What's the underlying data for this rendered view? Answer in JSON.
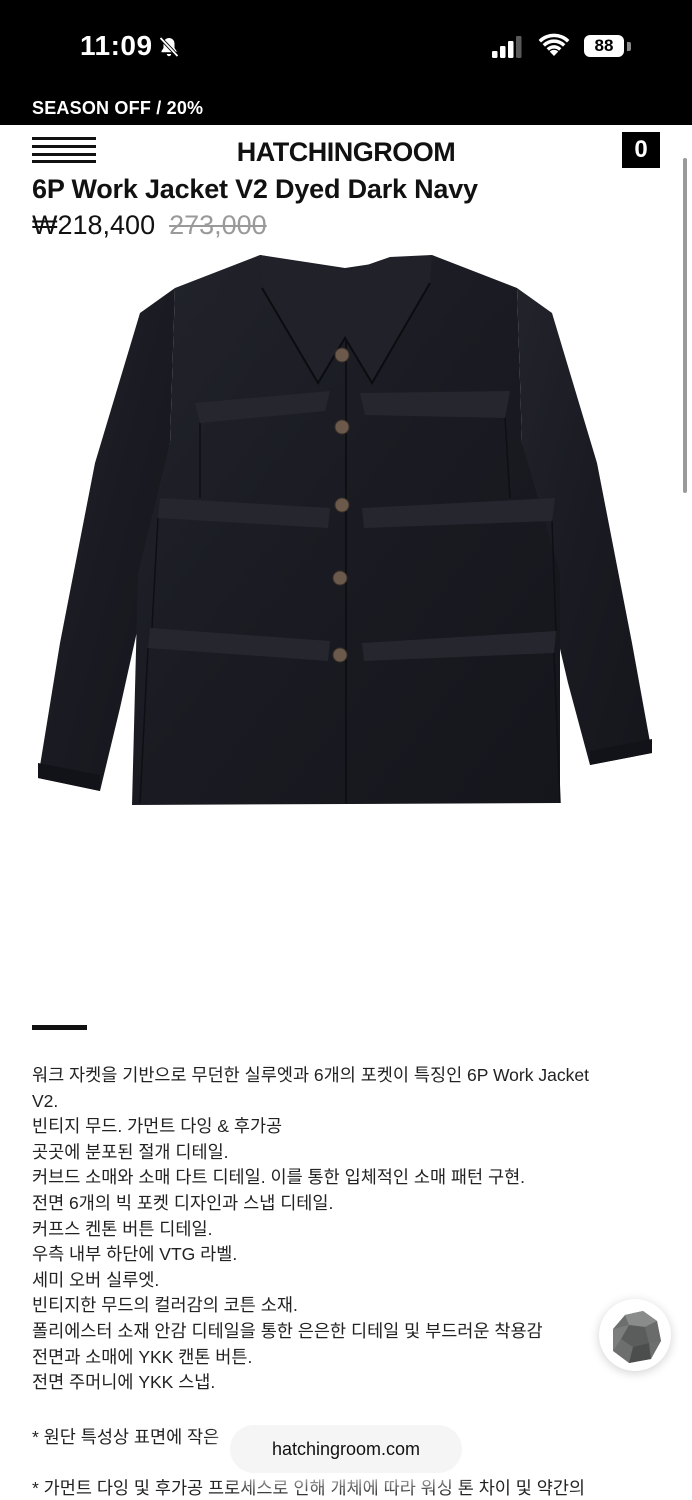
{
  "status_bar": {
    "time": "11:09",
    "battery": "88"
  },
  "promo": {
    "text": "SEASON OFF / 20%"
  },
  "header": {
    "brand": "HATCHINGROOM",
    "cart_count": "0"
  },
  "product": {
    "title": "6P Work Jacket V2 Dyed Dark Navy",
    "sale_price": "₩218,400",
    "original_price": "273,000"
  },
  "description": {
    "lines": [
      "워크 자켓을 기반으로 무던한 실루엣과 6개의 포켓이 특징인 6P Work Jacket",
      "V2.",
      "빈티지 무드. 가먼트 다잉 & 후가공",
      "곳곳에 분포된 절개 디테일.",
      "커브드 소매와 소매 다트 디테일. 이를 통한 입체적인 소매 패턴 구현.",
      "전면 6개의 빅 포켓 디자인과 스냅 디테일.",
      "커프스 켄톤 버튼 디테일.",
      "우측 내부 하단에 VTG 라벨.",
      "세미 오버 실루엣.",
      "빈티지한 무드의 컬러감의 코튼 소재.",
      "폴리에스터 소재 안감 디테일을 통한 은은한 디테일 및 부드러운 착용감",
      "전면과 소매에 YKK 캔톤 버튼.",
      "전면 주머니에 YKK 스냅."
    ],
    "note_1": "* 원단 특성상 표면에 작은",
    "note_2": "* 가먼트 다잉 및 후가공 프로세스로 인해 개체에 따라 워싱 톤 차이 및 약간의"
  },
  "browser": {
    "url": "hatchingroom.com"
  },
  "icons": {
    "menu": "hamburger-menu-icon",
    "mute": "bell-slash-icon",
    "signal": "cellular-signal-icon",
    "wifi": "wifi-icon"
  },
  "colors": {
    "bar_bg": "#000000",
    "text": "#111111",
    "strike_price": "#9a9a9a"
  }
}
